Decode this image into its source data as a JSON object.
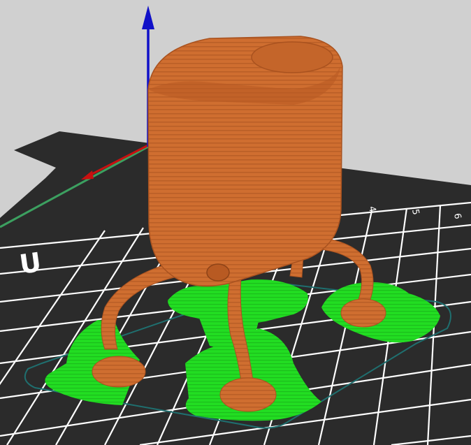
{
  "viewport": {
    "background": "#d0d0d0",
    "bed_color": "#2b2b2b",
    "grid_color": "#ffffff"
  },
  "bed": {
    "tick_labels": [
      "4",
      "5",
      "6"
    ],
    "logo_glyph": "U"
  },
  "axes": {
    "z_color": "#1010c8",
    "x_color": "#c81010",
    "y_color": "#3ca060"
  },
  "model": {
    "body_color": "#cf6e30",
    "support_color": "#22dd22",
    "outline_color": "#1f6f6f"
  }
}
